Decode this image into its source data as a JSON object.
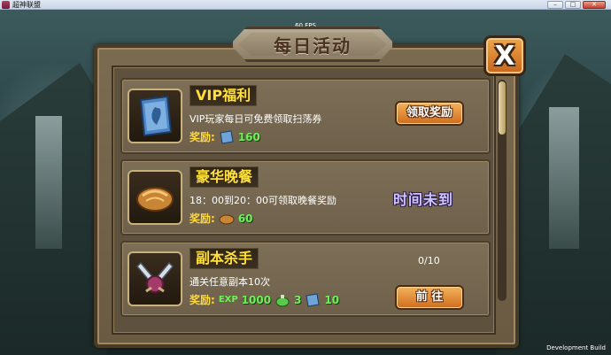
{
  "window": {
    "title": "超神联盟",
    "minimize": "–",
    "maximize": "□",
    "close": "✕"
  },
  "hud": {
    "fps": "60 FPS",
    "build": "Development Build"
  },
  "dialog": {
    "title": "每日活动",
    "close_glyph": "X"
  },
  "scroll": {
    "position": 0
  },
  "activities": [
    {
      "name": "VIP福利",
      "description": "VIP玩家每日可免费领取扫荡券",
      "reward_label": "奖励:",
      "rewards": [
        {
          "icon": "sweep-ticket-icon",
          "value": "160"
        }
      ],
      "action": {
        "type": "button",
        "label": "领取奖励"
      },
      "icon": "scroll-icon"
    },
    {
      "name": "豪华晚餐",
      "description": "18：00到20：00可领取晚餐奖励",
      "reward_label": "奖励:",
      "rewards": [
        {
          "icon": "bread-icon",
          "value": "60"
        }
      ],
      "action": {
        "type": "status",
        "label": "时间未到"
      },
      "icon": "bread-icon"
    },
    {
      "name": "副本杀手",
      "description": "通关任意副本10次",
      "reward_label": "奖励:",
      "progress": "0/10",
      "rewards": [
        {
          "icon": "exp-label",
          "prefix": "EXP",
          "value": "1000"
        },
        {
          "icon": "potion-icon",
          "value": "3"
        },
        {
          "icon": "sweep-ticket-icon",
          "value": "10"
        }
      ],
      "action": {
        "type": "button",
        "label": "前 往"
      },
      "icon": "crossed-swords-icon"
    }
  ]
}
